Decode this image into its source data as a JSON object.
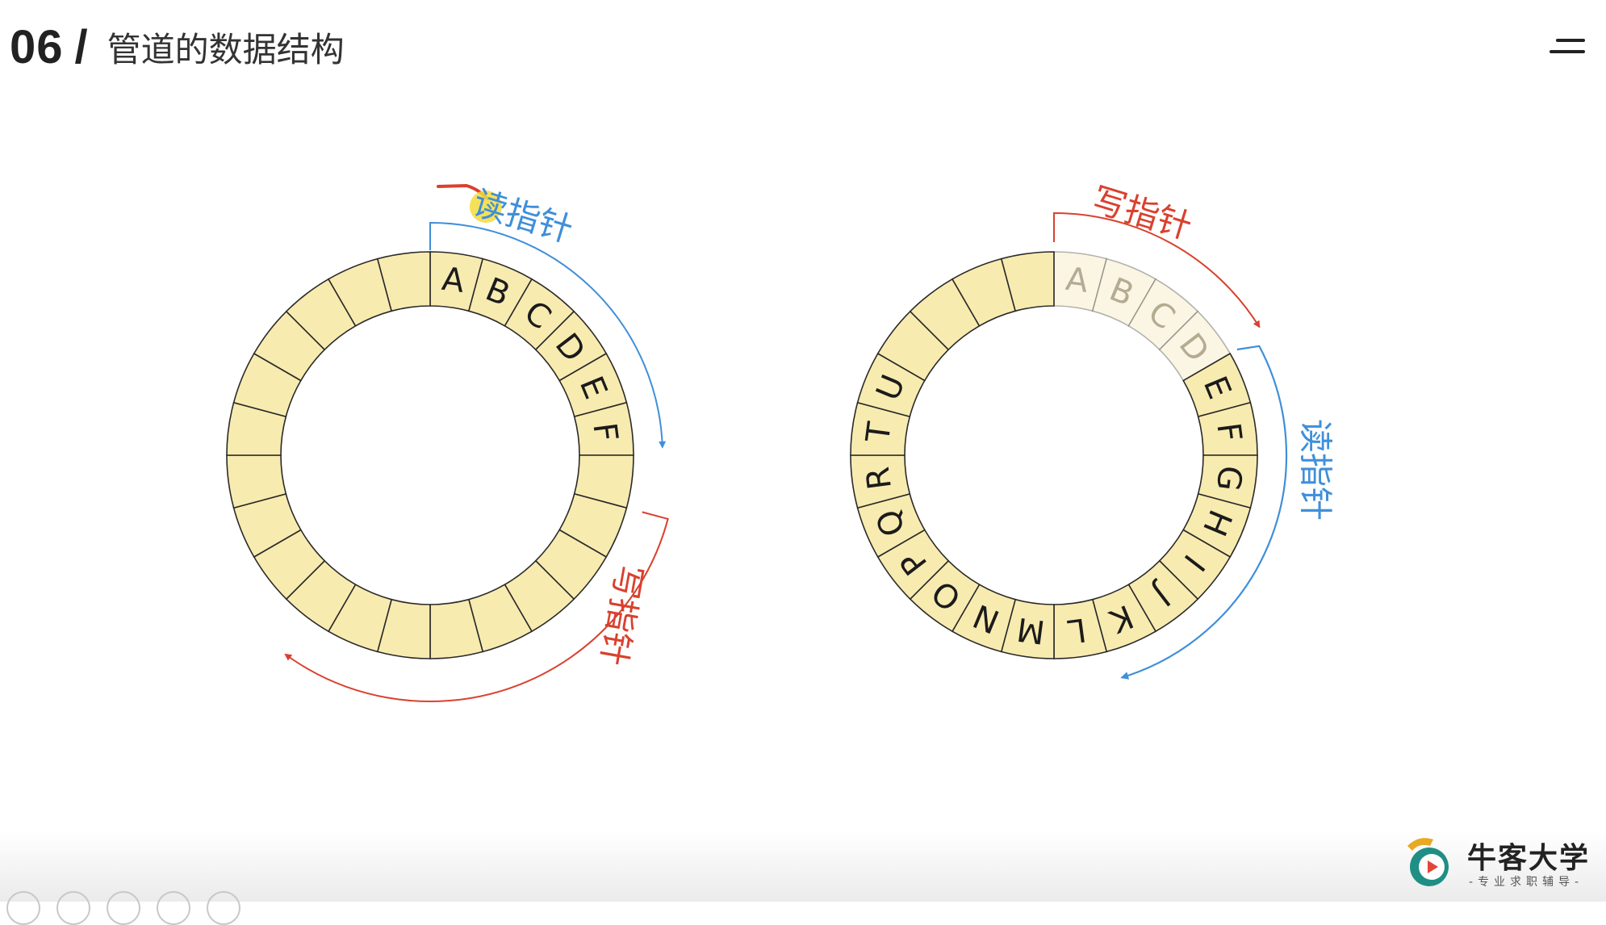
{
  "header": {
    "slide_number": "06",
    "separator": "/",
    "title": "管道的数据结构"
  },
  "diagram": {
    "left_ring": {
      "segment_count": 24,
      "filled_letters": [
        "A",
        "B",
        "C",
        "D",
        "E",
        "F"
      ],
      "read_pointer_label": "读指针",
      "write_pointer_label": "写指针"
    },
    "right_ring": {
      "segment_count": 24,
      "consumed_letters": [
        "A",
        "B",
        "C",
        "D"
      ],
      "unread_letters": [
        "E",
        "F",
        "G",
        "H",
        "I",
        "J",
        "K",
        "L",
        "M",
        "N",
        "O",
        "P",
        "Q",
        "R",
        "T",
        "U"
      ],
      "write_pointer_label": "写指针",
      "read_pointer_label": "读指针"
    }
  },
  "colors": {
    "segment_fill": "#f8ebb0",
    "segment_fill_faded": "#fbf6e4",
    "ring_stroke": "#2a2a2a",
    "read_pointer": "#3f8fd9",
    "write_pointer": "#d9412e",
    "highlight_dot": "#f3dc3c"
  },
  "brand": {
    "name": "牛客大学",
    "subtitle": "-专业求职辅导-"
  },
  "icons": {
    "menu": "hamburger-menu-icon",
    "brand": "niuke-logo-icon",
    "toolbar": [
      "arrow-tool-icon",
      "pen-tool-icon",
      "text-tool-icon",
      "search-tool-icon",
      "more-tool-icon"
    ]
  }
}
